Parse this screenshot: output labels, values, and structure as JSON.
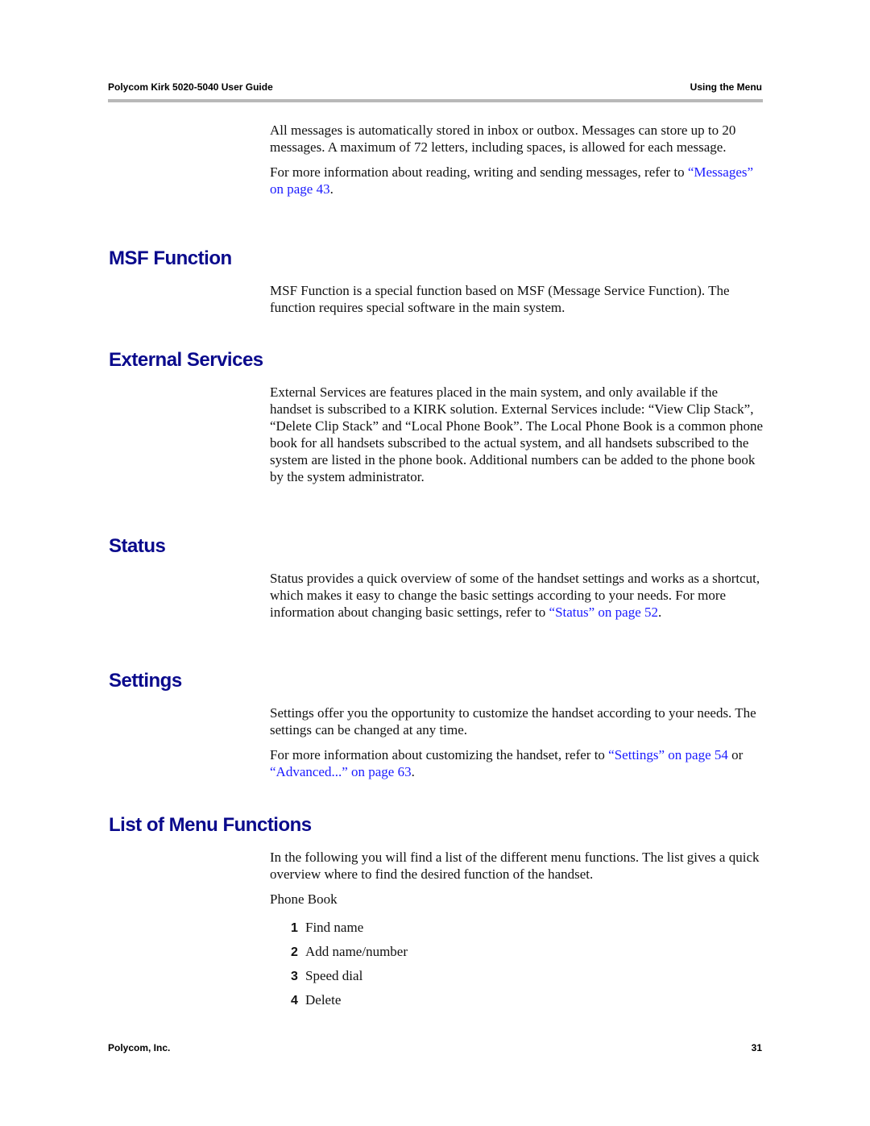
{
  "header": {
    "title": "Polycom Kirk 5020-5040 User Guide",
    "section": "Using the Menu"
  },
  "intro": {
    "p1": "All messages is automatically stored in inbox or outbox. Messages can store up to 20 messages. A maximum of 72 letters, including spaces, is allowed for each message.",
    "p2_text": "For more information about reading, writing and sending messages, refer to ",
    "p2_link": "“Messages” on page 43",
    "p2_end": "."
  },
  "sections": {
    "msf": {
      "title": "MSF Function",
      "p1": "MSF Function is a special function based on MSF (Message Service Function). The function requires special software in the main system."
    },
    "external": {
      "title": "External Services",
      "p1": "External Services are features placed in the main system, and only available if the handset is subscribed to a KIRK solution. External Services include: “View Clip Stack”, “Delete Clip Stack” and “Local Phone Book”. The Local Phone Book is a common phone book for all handsets subscribed to the actual system, and all handsets subscribed to the system are listed in the phone book. Additional numbers can be added to the phone book by the system administrator."
    },
    "status": {
      "title": "Status",
      "p1_text": "Status provides a quick overview of some of the handset settings and works as a shortcut, which makes it easy to change the basic settings according to your needs. For more information about changing basic settings, refer to ",
      "p1_link": "“Status” on page 52",
      "p1_end": "."
    },
    "settings": {
      "title": "Settings",
      "p1": "Settings offer you the opportunity to customize the handset according to your needs. The settings can be changed at any time.",
      "p2_text": "For more information about customizing the handset, refer to ",
      "p2_link1": "“Settings” on page 54",
      "p2_mid": " or ",
      "p2_link2": "“Advanced...” on page 63",
      "p2_end": "."
    },
    "menu_list": {
      "title": "List of Menu Functions",
      "p1": "In the following you will find a list of the different menu functions. The list gives a quick overview where to find the desired function of the handset.",
      "subheading": "Phone Book",
      "items": [
        {
          "num": "1",
          "label": "Find name"
        },
        {
          "num": "2",
          "label": "Add name/number"
        },
        {
          "num": "3",
          "label": "Speed dial"
        },
        {
          "num": "4",
          "label": "Delete"
        }
      ]
    }
  },
  "footer": {
    "company": "Polycom, Inc.",
    "page_number": "31"
  },
  "colors": {
    "heading": "#0a0a8c",
    "link": "#1a1aff",
    "rule": "#b8b8b8"
  }
}
